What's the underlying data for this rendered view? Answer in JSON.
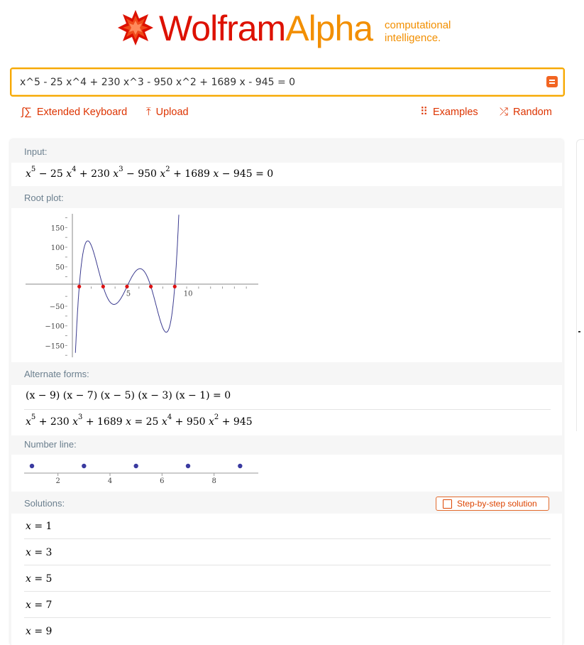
{
  "header": {
    "logo_wolfram": "Wolfram",
    "logo_alpha": "Alpha",
    "tagline_line1": "computational",
    "tagline_line2": "intelligence."
  },
  "search": {
    "value": "x^5 - 25 x^4 + 230 x^3 - 950 x^2 + 1689 x - 945 = 0"
  },
  "toolbar": {
    "extended_keyboard": "Extended Keyboard",
    "upload": "Upload",
    "examples": "Examples",
    "random": "Random"
  },
  "pods": {
    "input_title": "Input:",
    "root_plot_title": "Root plot:",
    "alternate_forms_title": "Alternate forms:",
    "number_line_title": "Number line:",
    "solutions_title": "Solutions:",
    "step_by_step": "Step-by-step solution"
  },
  "input_math": {
    "t1": "x",
    "e1": "5",
    "t2": " − 25 ",
    "t3": "x",
    "e2": "4",
    "t4": " + 230 ",
    "t5": "x",
    "e3": "3",
    "t6": " − 950 ",
    "t7": "x",
    "e4": "2",
    "t8": " + 1689 ",
    "t9": "x",
    "t10": " − 945 = 0"
  },
  "alternate_forms": {
    "factored": "(x − 9) (x − 7) (x − 5) (x − 3) (x − 1) = 0",
    "rearranged": {
      "t1": "x",
      "e1": "5",
      "t2": " + 230 ",
      "t3": "x",
      "e2": "3",
      "t4": " + 1689 ",
      "t5": "x",
      "t6": " = 25 ",
      "t7": "x",
      "e3": "4",
      "t8": " + 950 ",
      "t9": "x",
      "e4": "2",
      "t10": " + 945"
    }
  },
  "solutions": [
    {
      "var": "x",
      "rest": " = 1"
    },
    {
      "var": "x",
      "rest": " = 3"
    },
    {
      "var": "x",
      "rest": " = 5"
    },
    {
      "var": "x",
      "rest": " = 7"
    },
    {
      "var": "x",
      "rest": " = 9"
    }
  ],
  "root_plot": {
    "x_ticks": [
      "5",
      "10"
    ],
    "y_ticks": [
      "150",
      "100",
      "50",
      "−50",
      "−100",
      "−150"
    ],
    "roots": [
      1,
      3,
      5,
      7,
      9
    ],
    "x_range": [
      -3.5,
      16
    ],
    "y_range": [
      -180,
      185
    ],
    "curve_color": "#3b3b8f",
    "root_color": "#dd1111"
  },
  "number_line": {
    "ticks": [
      "2",
      "4",
      "6",
      "8"
    ],
    "points": [
      1,
      3,
      5,
      7,
      9
    ],
    "x_range": [
      0.7,
      9.7
    ],
    "point_color": "#3a3aa0"
  },
  "colors": {
    "accent": "#dd3300",
    "search_border": "#f6a800",
    "pod_title": "#6b7f8e"
  }
}
